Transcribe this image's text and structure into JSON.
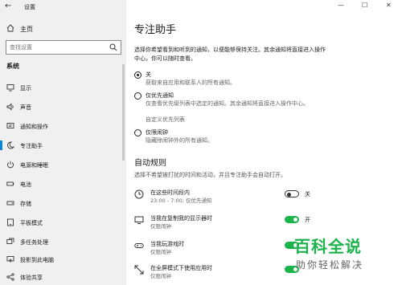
{
  "window": {
    "title": "设置",
    "back_glyph": "←",
    "min_glyph": "—",
    "max_glyph": "☐",
    "close_glyph": "✕"
  },
  "sidebar": {
    "home_label": "主页",
    "search_placeholder": "查找设置",
    "section_label": "系统",
    "items": [
      {
        "label": "显示",
        "icon": "display-icon"
      },
      {
        "label": "声音",
        "icon": "speaker-icon"
      },
      {
        "label": "通知和操作",
        "icon": "notification-icon"
      },
      {
        "label": "专注助手",
        "icon": "moon-icon",
        "active": true
      },
      {
        "label": "电源和睡眠",
        "icon": "power-icon"
      },
      {
        "label": "电池",
        "icon": "battery-icon"
      },
      {
        "label": "存储",
        "icon": "storage-icon"
      },
      {
        "label": "平板模式",
        "icon": "tablet-icon"
      },
      {
        "label": "多任务处理",
        "icon": "multitask-icon"
      },
      {
        "label": "投影到此电脑",
        "icon": "project-icon"
      },
      {
        "label": "体验共享",
        "icon": "share-icon"
      }
    ]
  },
  "main": {
    "title": "专注助手",
    "description": "选择你希望看到和听到的通知，以便能够保持关注。其余通知将直接进入操作中心，你可以随时查看。",
    "options": [
      {
        "label": "关",
        "desc": "获取来自应用和联系人的所有通知。",
        "selected": true
      },
      {
        "label": "仅优先通知",
        "desc": "仅查看优先级列表中选定的通知。其余通知将直接进入操作中心。",
        "link": "自定义优先列表",
        "selected": false
      },
      {
        "label": "仅限闹钟",
        "desc": "隐藏除闹钟外的所有通知。",
        "selected": false
      }
    ],
    "rules_title": "自动规则",
    "rules_desc": "选择不希望被打扰的时间和活动，并且专注助手会自动打开。",
    "rules": [
      {
        "title": "在这些时间段内",
        "sub": "23:00 - 7:00; 仅优先通知",
        "icon": "clock-icon",
        "on": false,
        "state": "关"
      },
      {
        "title": "当我在复制我的显示器时",
        "sub": "仅限闹钟",
        "icon": "monitor-icon",
        "on": true,
        "state": "开"
      },
      {
        "title": "当我玩游戏时",
        "sub": "仅限闹钟",
        "icon": "gamepad-icon",
        "on": true,
        "state": ""
      },
      {
        "title": "在全屏模式下使用应用时",
        "sub": "仅限闹钟",
        "icon": "fullscreen-icon",
        "on": true,
        "state": ""
      }
    ]
  },
  "watermark": {
    "brand": "百科全说",
    "slogan": "助你轻松解决"
  },
  "colors": {
    "accent": "#1bb34c",
    "active_bar": "#0a84d6",
    "sidebar_bg": "#f0f0f0"
  }
}
